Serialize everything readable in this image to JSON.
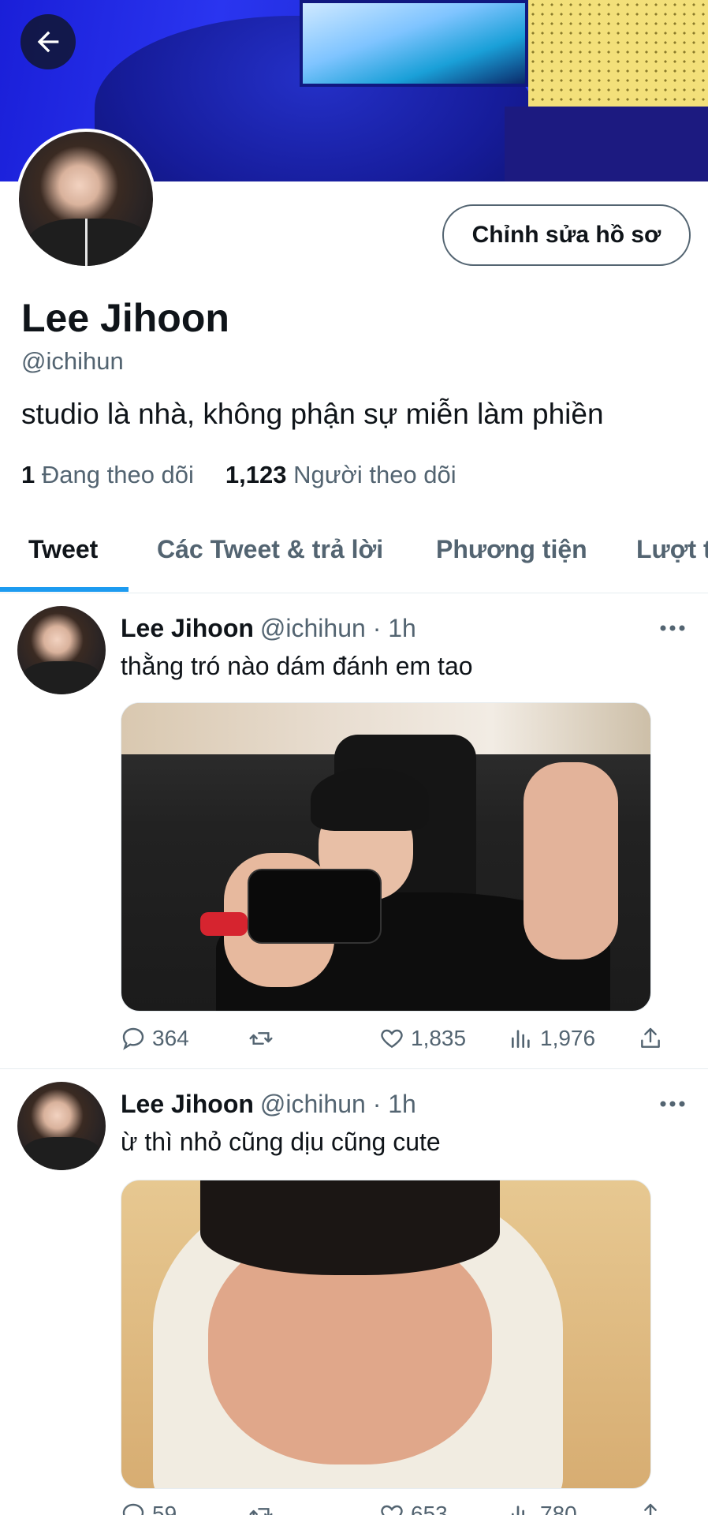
{
  "profile": {
    "name": "Lee Jihoon",
    "handle": "@ichihun",
    "bio": "studio là nhà, không phận sự miễn làm phiền",
    "following_count": "1",
    "following_label": "Đang theo dõi",
    "followers_count": "1,123",
    "followers_label": "Người theo dõi",
    "edit_label": "Chỉnh sửa hồ sơ"
  },
  "tabs": [
    {
      "label": "Tweet",
      "active": true
    },
    {
      "label": "Các Tweet & trả lời",
      "active": false
    },
    {
      "label": "Phương tiện",
      "active": false
    },
    {
      "label": "Lượt t",
      "active": false
    }
  ],
  "tweets": [
    {
      "name": "Lee Jihoon",
      "meta": "@ichihun · 1h",
      "text": "thằng tró nào dám đánh em tao",
      "replies": "364",
      "retweets": "",
      "likes": "1,835",
      "views": "1,976"
    },
    {
      "name": "Lee Jihoon",
      "meta": "@ichihun · 1h",
      "text": "ừ thì nhỏ cũng dịu cũng cute",
      "replies": "59",
      "retweets": "",
      "likes": "653",
      "views": "780"
    }
  ],
  "colors": {
    "accent": "#1d9bf0",
    "text_primary": "#0f1419",
    "text_secondary": "#536471"
  }
}
